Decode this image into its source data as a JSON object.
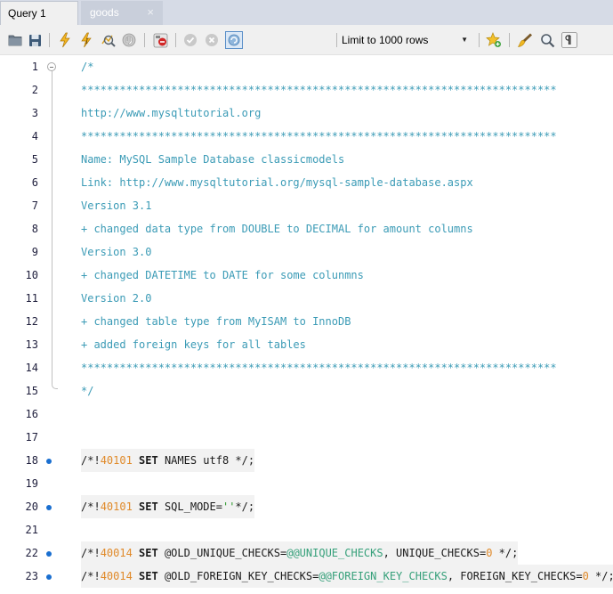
{
  "tabs": [
    {
      "label": "Query 1",
      "active": true
    },
    {
      "label": "goods",
      "active": false,
      "close_glyph": "×"
    }
  ],
  "toolbar": {
    "icons": [
      "open-folder-icon",
      "save-icon",
      "execute-icon",
      "execute-current-icon",
      "explain-icon",
      "stop-icon",
      "toggle-error-icon",
      "commit-icon",
      "rollback-icon",
      "autocommit-icon",
      "add-snippet-icon",
      "beautify-icon",
      "find-icon",
      "invisible-chars-icon"
    ],
    "limit": {
      "selected": "Limit to 1000 rows"
    }
  },
  "editor": {
    "lines": [
      {
        "n": "1",
        "text": "/*"
      },
      {
        "n": "2",
        "text": "**************************************************************************"
      },
      {
        "n": "3",
        "text": "http://www.mysqltutorial.org"
      },
      {
        "n": "4",
        "text": "**************************************************************************"
      },
      {
        "n": "5",
        "text": "Name: MySQL Sample Database classicmodels"
      },
      {
        "n": "6",
        "text": "Link: http://www.mysqltutorial.org/mysql-sample-database.aspx"
      },
      {
        "n": "7",
        "text": "Version 3.1"
      },
      {
        "n": "8",
        "text": "+ changed data type from DOUBLE to DECIMAL for amount columns"
      },
      {
        "n": "9",
        "text": "Version 3.0"
      },
      {
        "n": "10",
        "text": "+ changed DATETIME to DATE for some colunmns"
      },
      {
        "n": "11",
        "text": "Version 2.0"
      },
      {
        "n": "12",
        "text": "+ changed table type from MyISAM to InnoDB"
      },
      {
        "n": "13",
        "text": "+ added foreign keys for all tables"
      },
      {
        "n": "14",
        "text": "**************************************************************************"
      },
      {
        "n": "15",
        "text": "*/"
      },
      {
        "n": "16",
        "text": ""
      },
      {
        "n": "17",
        "text": ""
      },
      {
        "n": "18",
        "stmt": [
          {
            "t": "/*!",
            "c": "plain"
          },
          {
            "t": "40101",
            "c": "num"
          },
          {
            "t": " SET",
            "c": "kw"
          },
          {
            "t": " NAMES utf8 */;",
            "c": "plain"
          }
        ]
      },
      {
        "n": "19",
        "text": ""
      },
      {
        "n": "20",
        "stmt": [
          {
            "t": "/*!",
            "c": "plain"
          },
          {
            "t": "40101",
            "c": "num"
          },
          {
            "t": " SET",
            "c": "kw"
          },
          {
            "t": " SQL_MODE=",
            "c": "plain"
          },
          {
            "t": "''",
            "c": "str"
          },
          {
            "t": "*/;",
            "c": "plain"
          }
        ]
      },
      {
        "n": "21",
        "text": ""
      },
      {
        "n": "22",
        "stmt": [
          {
            "t": "/*!",
            "c": "plain"
          },
          {
            "t": "40014",
            "c": "num"
          },
          {
            "t": " SET",
            "c": "kw"
          },
          {
            "t": " @OLD_UNIQUE_CHECKS=",
            "c": "plain"
          },
          {
            "t": "@@UNIQUE_CHECKS",
            "c": "var"
          },
          {
            "t": ", UNIQUE_CHECKS=",
            "c": "plain"
          },
          {
            "t": "0",
            "c": "num"
          },
          {
            "t": " */;",
            "c": "plain"
          }
        ]
      },
      {
        "n": "23",
        "stmt": [
          {
            "t": "/*!",
            "c": "plain"
          },
          {
            "t": "40014",
            "c": "num"
          },
          {
            "t": " SET",
            "c": "kw"
          },
          {
            "t": " @OLD_FOREIGN_KEY_CHECKS=",
            "c": "plain"
          },
          {
            "t": "@@FOREIGN_KEY_CHECKS",
            "c": "var"
          },
          {
            "t": ", FOREIGN_KEY_CHECKS=",
            "c": "plain"
          },
          {
            "t": "0",
            "c": "num"
          },
          {
            "t": " */;",
            "c": "plain"
          }
        ]
      }
    ]
  },
  "colors": {
    "comment": "#3b9bb6",
    "number": "#e08a2a",
    "string": "#2e9a2e",
    "system_variable": "#36a07a",
    "statement_marker": "#1a6fd0",
    "tab_bar": "#d6dbe6"
  }
}
